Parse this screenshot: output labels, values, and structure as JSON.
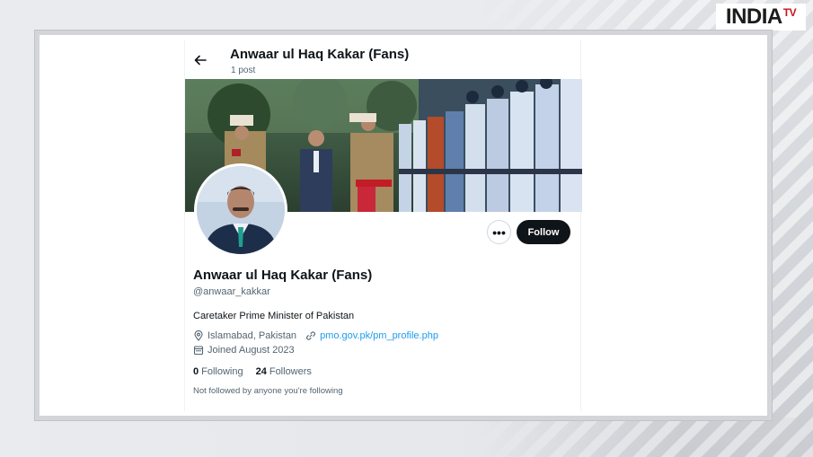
{
  "branding": {
    "logo_main": "INDIA",
    "logo_sup": "TV"
  },
  "topbar": {
    "name": "Anwaar ul Haq Kakar (Fans)",
    "posts": "1 post"
  },
  "profile": {
    "display_name": "Anwaar ul Haq Kakar (Fans)",
    "handle": "@anwaar_kakkar",
    "bio": "Caretaker Prime Minister of Pakistan",
    "location": "Islamabad, Pakistan",
    "website": "pmo.gov.pk/pm_profile.php",
    "joined": "Joined August 2023"
  },
  "actions": {
    "more": "•••",
    "follow": "Follow"
  },
  "stats": {
    "following_count": "0",
    "following_label": "Following",
    "followers_count": "24",
    "followers_label": "Followers"
  },
  "note": "Not followed by anyone you're following",
  "colors": {
    "link": "#1d9bf0",
    "follow_bg": "#0f1419",
    "logo_red": "#c6161c"
  },
  "icons": [
    "back-arrow-icon",
    "location-pin-icon",
    "link-icon",
    "calendar-icon"
  ]
}
